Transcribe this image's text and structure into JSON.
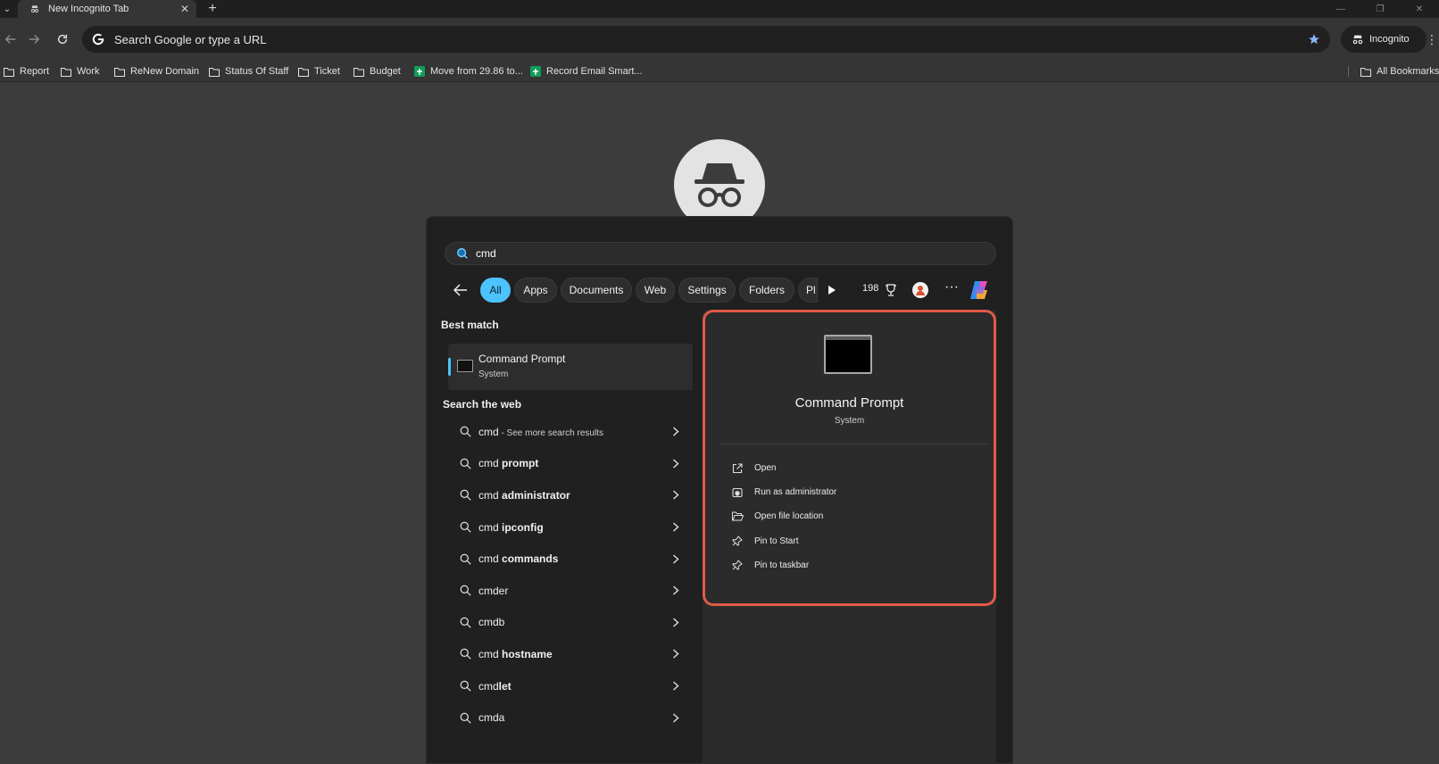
{
  "browser": {
    "tab": {
      "title": "New Incognito Tab",
      "close_glyph": "✕"
    },
    "new_tab_glyph": "+",
    "tab_search_glyph": "⌄",
    "window_controls": {
      "minimize": "—",
      "restore": "❐",
      "close": "✕"
    },
    "omnibox": {
      "placeholder": "Search Google or type a URL"
    },
    "profile_chip": {
      "label": "Incognito"
    },
    "menu_glyph": "⋮",
    "bookmarks": [
      {
        "label": "Report",
        "icon": "folder-icon"
      },
      {
        "label": "Work",
        "icon": "folder-icon"
      },
      {
        "label": "ReNew Domain",
        "icon": "folder-icon"
      },
      {
        "label": "Status Of Staff",
        "icon": "folder-icon"
      },
      {
        "label": "Ticket",
        "icon": "folder-icon"
      },
      {
        "label": "Budget",
        "icon": "folder-icon"
      },
      {
        "label": "Move from 29.86 to...",
        "icon": "sheets-icon"
      },
      {
        "label": "Record Email Smart...",
        "icon": "sheets-icon"
      }
    ],
    "all_bookmarks": "All Bookmarks"
  },
  "search": {
    "query": "cmd",
    "filters": [
      "All",
      "Apps",
      "Documents",
      "Web",
      "Settings",
      "Folders",
      "Pl"
    ],
    "active_filter": "All",
    "points": "198",
    "more_glyph": "···",
    "best_match_heading": "Best match",
    "best_match": {
      "title": "Command Prompt",
      "subtitle": "System"
    },
    "web_heading": "Search the web",
    "web_results": [
      {
        "prefix": "cmd",
        "bold": "",
        "hint": " - See more search results"
      },
      {
        "prefix": "cmd ",
        "bold": "prompt",
        "hint": ""
      },
      {
        "prefix": "cmd ",
        "bold": "administrator",
        "hint": ""
      },
      {
        "prefix": "cmd ",
        "bold": "ipconfig",
        "hint": ""
      },
      {
        "prefix": "cmd ",
        "bold": "commands",
        "hint": ""
      },
      {
        "prefix": "cmder",
        "bold": "",
        "hint": ""
      },
      {
        "prefix": "cmdb",
        "bold": "",
        "hint": ""
      },
      {
        "prefix": "cmd ",
        "bold": "hostname",
        "hint": ""
      },
      {
        "prefix": "cmd",
        "bold": "let",
        "hint": ""
      },
      {
        "prefix": "cmda",
        "bold": "",
        "hint": ""
      }
    ],
    "preview": {
      "title": "Command Prompt",
      "subtitle": "System",
      "actions": [
        {
          "label": "Open",
          "icon": "open-external-icon"
        },
        {
          "label": "Run as administrator",
          "icon": "shield-admin-icon"
        },
        {
          "label": "Open file location",
          "icon": "folder-open-icon"
        },
        {
          "label": "Pin to Start",
          "icon": "pin-icon"
        },
        {
          "label": "Pin to taskbar",
          "icon": "pin-icon"
        }
      ]
    }
  },
  "colors": {
    "accent": "#4cc2ff",
    "highlight_border": "#e05a48",
    "sheets_green": "#0f9d58"
  }
}
